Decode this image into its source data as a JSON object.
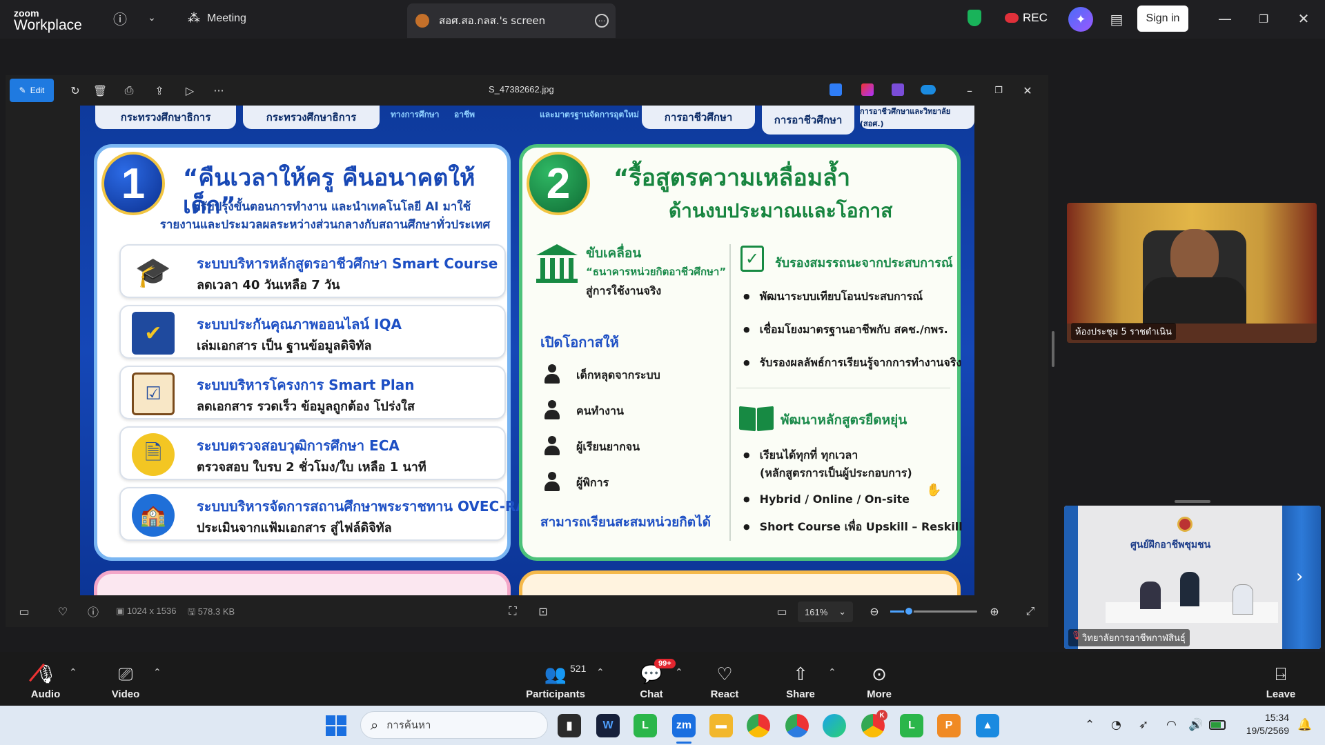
{
  "zoom": {
    "logo_small": "zoom",
    "logo_big": "Workplace",
    "meeting_label": "Meeting",
    "screen_tab": "สอศ.สอ.กลส.'s screen",
    "rec_label": "REC",
    "sign_in": "Sign in"
  },
  "viewer": {
    "edit_label": "Edit",
    "filename": "S_47382662.jpg",
    "dimensions": "1024 x 1536",
    "filesize": "578.3 KB",
    "zoom_level": "161%"
  },
  "slide": {
    "top_pills": [
      "กระทรวงศึกษาธิการ",
      "กระทรวงศึกษาธิการ",
      "ทางการศึกษา",
      "อาชีพ",
      "และมาตรฐาน",
      "จัดการอุตใหม่",
      "การอาชีวศึกษา",
      "การอาชีวศึกษา",
      "การอาชีวศึกษาและวิทยาลัย (สอศ.)"
    ],
    "panel1": {
      "number": "1",
      "title": "“คืนเวลาให้ครู คืนอนาคตให้เด็ก”",
      "subtitle1": "ปรับปรุงขั้นตอนการทำงาน และนำเทคโนโลยี AI มาใช้",
      "subtitle2": "รายงานและประมวลผลระหว่างส่วนกลางกับสถานศึกษาทั่วประเทศ",
      "items": [
        {
          "title": "ระบบบริหารหลักสูตรอาชีวศึกษา Smart Course",
          "desc": "ลดเวลา 40 วันเหลือ 7 วัน",
          "icon": "graduation-cap-icon"
        },
        {
          "title": "ระบบประกันคุณภาพออนไลน์ IQA",
          "desc": "เล่มเอกสาร เป็น ฐานข้อมูลดิจิทัล",
          "icon": "monitor-check-icon"
        },
        {
          "title": "ระบบบริหารโครงการ Smart Plan",
          "desc": "ลดเอกสาร รวดเร็ว ข้อมูลถูกต้อง โปร่งใส",
          "icon": "clipboard-checklist-icon"
        },
        {
          "title": "ระบบตรวจสอบวุฒิการศึกษา ECA",
          "desc": "ตรวจสอบ ใบรบ 2 ชั่วโมง/ใบ เหลือ 1 นาที",
          "icon": "document-clock-icon"
        },
        {
          "title": "ระบบบริหารจัดการสถานศึกษาพระราชทาน OVEC-RA",
          "desc": "ประเมินจากแฟ้มเอกสาร สู่ไฟล์ดิจิทัล",
          "icon": "school-building-icon"
        }
      ]
    },
    "panel2": {
      "number": "2",
      "title1": "“รื้อสูตรความเหลื่อมล้ำ",
      "title2": "ด้านงบประมาณและโอกาส",
      "drive_label": "ขับเคลื่อน",
      "drive_bank": "“ธนาคารหน่วยกิตอาชีวศึกษา”",
      "drive_use": "สู่การใช้งานจริง",
      "open_label": "เปิดโอกาสให้",
      "groups": [
        "เด็กหลุดจากระบบ",
        "คนทำงาน",
        "ผู้เรียนยากจน",
        "ผู้พิการ"
      ],
      "accumulate": "สามารถเรียนสะสมหน่วยกิตได้",
      "certify_title": "รับรองสมรรถนะจากประสบการณ์",
      "certify_items": [
        "พัฒนาระบบเทียบโอนประสบการณ์",
        "เชื่อมโยงมาตรฐานอาชีพกับ สคช./กพร.",
        "รับรองผลลัพธ์การเรียนรู้จากการทำงานจริง"
      ],
      "flex_title": "พัฒนาหลักสูตรยืดหยุ่น",
      "flex_item1a": "เรียนได้ทุกที่ ทุกเวลา",
      "flex_item1b": "(หลักสูตรการเป็นผู้ประกอบการ)",
      "flex_item2": "Hybrid / Online / On-site",
      "flex_item3": "Short Course เพื่อ Upskill – Reskill"
    }
  },
  "tiles": [
    {
      "name": "ห้องประชุม 5 ราชดำเนิน"
    },
    {
      "name": "วิทยาลัยการอาชีพกาฬสินธุ์",
      "banner": "ศูนย์ฝึกอาชีพชุมชน"
    }
  ],
  "controls": {
    "audio": "Audio",
    "video": "Video",
    "participants": "Participants",
    "participants_count": "521",
    "chat": "Chat",
    "chat_badge": "99+",
    "react": "React",
    "share": "Share",
    "more": "More",
    "leave": "Leave"
  },
  "taskbar": {
    "search_placeholder": "การค้นหา",
    "time": "15:34",
    "date": "19/5/2569",
    "notification_badge": "K"
  },
  "colors": {
    "accent_blue": "#1f7ae0",
    "slide_blue": "#1547b7",
    "green": "#1a8a4a",
    "rec_red": "#e0303a"
  }
}
